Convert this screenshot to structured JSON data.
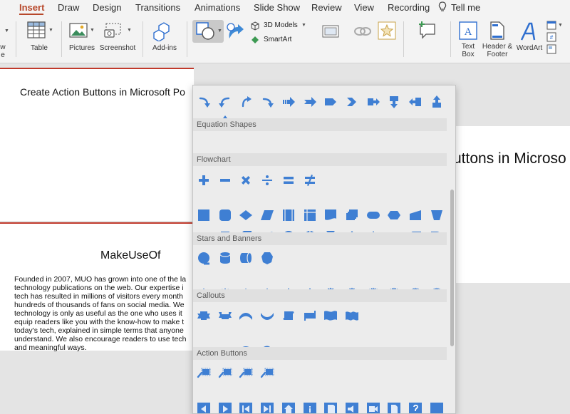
{
  "tabs": [
    {
      "label": "Insert",
      "active": true
    },
    {
      "label": "Draw"
    },
    {
      "label": "Design"
    },
    {
      "label": "Transitions"
    },
    {
      "label": "Animations"
    },
    {
      "label": "Slide Show"
    },
    {
      "label": "Review"
    },
    {
      "label": "View"
    },
    {
      "label": "Recording"
    },
    {
      "label": "Tell me"
    }
  ],
  "ribbon": {
    "new_label_fragment": "w",
    "new_label_fragment2": "e",
    "table": "Table",
    "pictures": "Pictures",
    "screenshot": "Screenshot",
    "addins": "Add-ins",
    "models3d": "3D Models",
    "smartart": "SmartArt",
    "textbox_line1": "Text",
    "textbox_line2": "Box",
    "header_line1": "Header &",
    "header_line2": "Footer",
    "wordart": "WordArt"
  },
  "slides": {
    "slide1_title": "Create Action Buttons in Microsoft Po",
    "right_title": "uttons in Microso",
    "slide2_heading": "MakeUseOf",
    "slide2_body": [
      "Founded in 2007, MUO has grown into one of the la",
      "technology publications on the web. Our expertise i",
      "tech has resulted in millions of visitors every month",
      "hundreds of thousands of fans on social media. We",
      "technology is only as useful as the one who uses it",
      "equip readers like you with the know-how to make t",
      "today's tech, explained in simple terms that anyone",
      "understand. We also encourage readers to use tech",
      "and meaningful ways."
    ]
  },
  "gallery": {
    "sections": [
      {
        "title": "Equation Shapes"
      },
      {
        "title": "Flowchart"
      },
      {
        "title": "Stars and Banners"
      },
      {
        "title": "Callouts"
      },
      {
        "title": "Action Buttons"
      }
    ],
    "shape_color": "#3f7fd3",
    "star_numbers": [
      "8",
      "10",
      "12",
      "16",
      "24",
      "32"
    ],
    "arrow_row1_icons": [
      "curved-arrow-right",
      "curved-arrow-left",
      "curved-arrow-up",
      "curved-arrow-down",
      "striped-arrow-right",
      "notched-arrow-right",
      "pentagon-arrow",
      "chevron-arrow",
      "callout-arrow-right",
      "callout-arrow-down",
      "callout-arrow-left",
      "callout-arrow-up"
    ],
    "arrow_row2_icons": [
      "left-right-callout-arrow",
      "quad-callout-arrow",
      "circular-arrow"
    ],
    "equation_icons": [
      "plus-icon",
      "minus-icon",
      "multiply-icon",
      "divide-icon",
      "equal-icon",
      "not-equal-icon"
    ]
  }
}
